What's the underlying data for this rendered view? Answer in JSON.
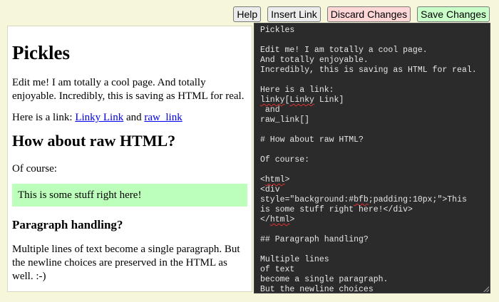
{
  "toolbar": {
    "help": "Help",
    "insert_link": "Insert Link",
    "discard": "Discard Changes",
    "save": "Save Changes"
  },
  "preview": {
    "title": "Pickles",
    "intro": "Edit me! I am totally a cool page. And totally enjoyable. Incredibly, this is saving as HTML for real.",
    "link_prefix": "Here is a link: ",
    "link1": "Linky Link",
    "link_and": " and ",
    "link2": "raw_link",
    "h2": "How about raw HTML?",
    "of_course": "Of course:",
    "greenbox": "This is some stuff right here!",
    "h3": "Paragraph handling?",
    "paragraph": "Multiple lines of text become a single paragraph. But the newline choices are preserved in the HTML as well. :-)"
  },
  "editor": {
    "lines": [
      "Pickles",
      "",
      "Edit me! I am totally a cool page.",
      "And totally enjoyable.",
      "Incredibly, this is saving as HTML for real.",
      "",
      "Here is a link:",
      "linky[Linky Link]",
      " and",
      "raw_link[]",
      "",
      "# How about raw HTML?",
      "",
      "Of course:",
      "",
      "<html>",
      "<div",
      "style=\"background:#bfb;padding:10px;\">This",
      "is some stuff right here!</div>",
      "</html>",
      "",
      "## Paragraph handling?",
      "",
      "Multiple lines",
      "of text",
      "become a single paragraph.",
      "But the newline choices"
    ]
  }
}
